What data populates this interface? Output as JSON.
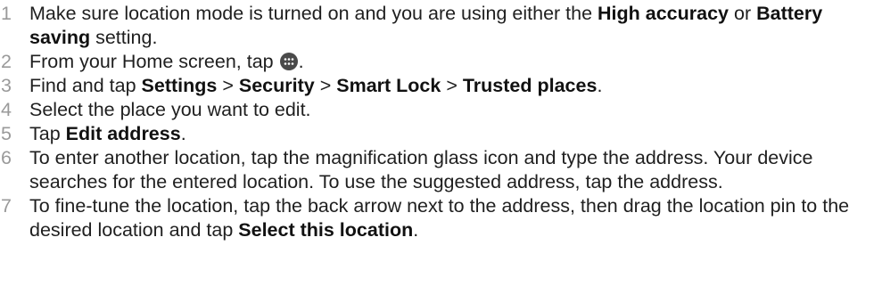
{
  "steps": [
    {
      "num": "1",
      "parts": [
        {
          "t": "Make sure location mode is turned on and you are using either the "
        },
        {
          "t": "High accuracy",
          "b": true
        },
        {
          "t": " or "
        },
        {
          "t": "Battery saving",
          "b": true
        },
        {
          "t": " setting."
        }
      ]
    },
    {
      "num": "2",
      "parts": [
        {
          "t": "From your Home screen, tap "
        },
        {
          "icon": "apps-grid-icon"
        },
        {
          "t": "."
        }
      ]
    },
    {
      "num": "3",
      "parts": [
        {
          "t": "Find and tap "
        },
        {
          "t": "Settings",
          "b": true
        },
        {
          "t": " > "
        },
        {
          "t": "Security",
          "b": true
        },
        {
          "t": " > "
        },
        {
          "t": "Smart Lock",
          "b": true
        },
        {
          "t": " > "
        },
        {
          "t": "Trusted places",
          "b": true
        },
        {
          "t": "."
        }
      ]
    },
    {
      "num": "4",
      "parts": [
        {
          "t": "Select the place you want to edit."
        }
      ]
    },
    {
      "num": "5",
      "parts": [
        {
          "t": "Tap "
        },
        {
          "t": "Edit address",
          "b": true
        },
        {
          "t": "."
        }
      ]
    },
    {
      "num": "6",
      "parts": [
        {
          "t": "To enter another location, tap the magnification glass icon and type the address. Your device searches for the entered location. To use the suggested address, tap the address."
        }
      ]
    },
    {
      "num": "7",
      "parts": [
        {
          "t": "To fine-tune the location, tap the back arrow next to the address, then drag the location pin to the desired location and tap "
        },
        {
          "t": "Select this location",
          "b": true
        },
        {
          "t": "."
        }
      ]
    }
  ],
  "colors": {
    "text": "#1f1f1f",
    "number": "#9a9a9a",
    "icon_bg": "#4a4a4a"
  }
}
